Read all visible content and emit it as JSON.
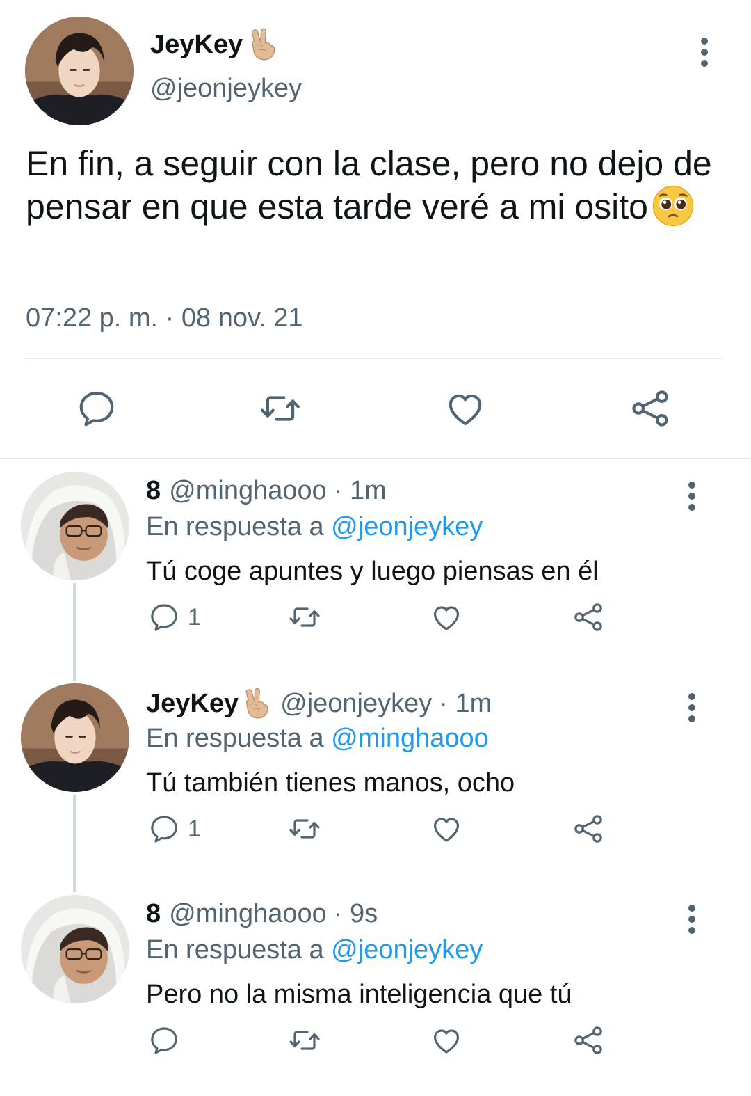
{
  "main_tweet": {
    "name": "JeyKey",
    "name_emoji": "victory-hand-emoji",
    "handle": "@jeonjeykey",
    "text": "En fin, a seguir con la clase, pero no dejo de pensar en que esta tarde veré a mi osito",
    "text_emoji": "pleading-face-emoji",
    "timestamp": "07:22 p. m. · 08 nov. 21",
    "actions": [
      "reply-icon",
      "retweet-icon",
      "like-icon",
      "share-icon"
    ]
  },
  "replies": [
    {
      "name": "8",
      "handle": "@minghaooo",
      "time": "· 1m",
      "in_reply_label": "En respuesta a ",
      "in_reply_to": "@jeonjeykey",
      "text": "Tú coge apuntes y luego piensas en él",
      "reply_count": "1"
    },
    {
      "name": "JeyKey",
      "name_emoji": "victory-hand-emoji",
      "handle": "@jeonjeykey",
      "time": "· 1m",
      "in_reply_label": "En respuesta a ",
      "in_reply_to": "@minghaooo",
      "text": "Tú también tienes manos, ocho",
      "reply_count": "1"
    },
    {
      "name": "8",
      "handle": "@minghaooo",
      "time": "· 9s",
      "in_reply_label": "En respuesta a ",
      "in_reply_to": "@jeonjeykey",
      "text": "Pero no la misma inteligencia que tú",
      "reply_count": ""
    }
  ],
  "colors": {
    "text": "#0f1419",
    "secondary": "#536471",
    "link": "#1d9bf0",
    "divider": "#e6e9eb",
    "thread_line": "#cfd9de"
  }
}
